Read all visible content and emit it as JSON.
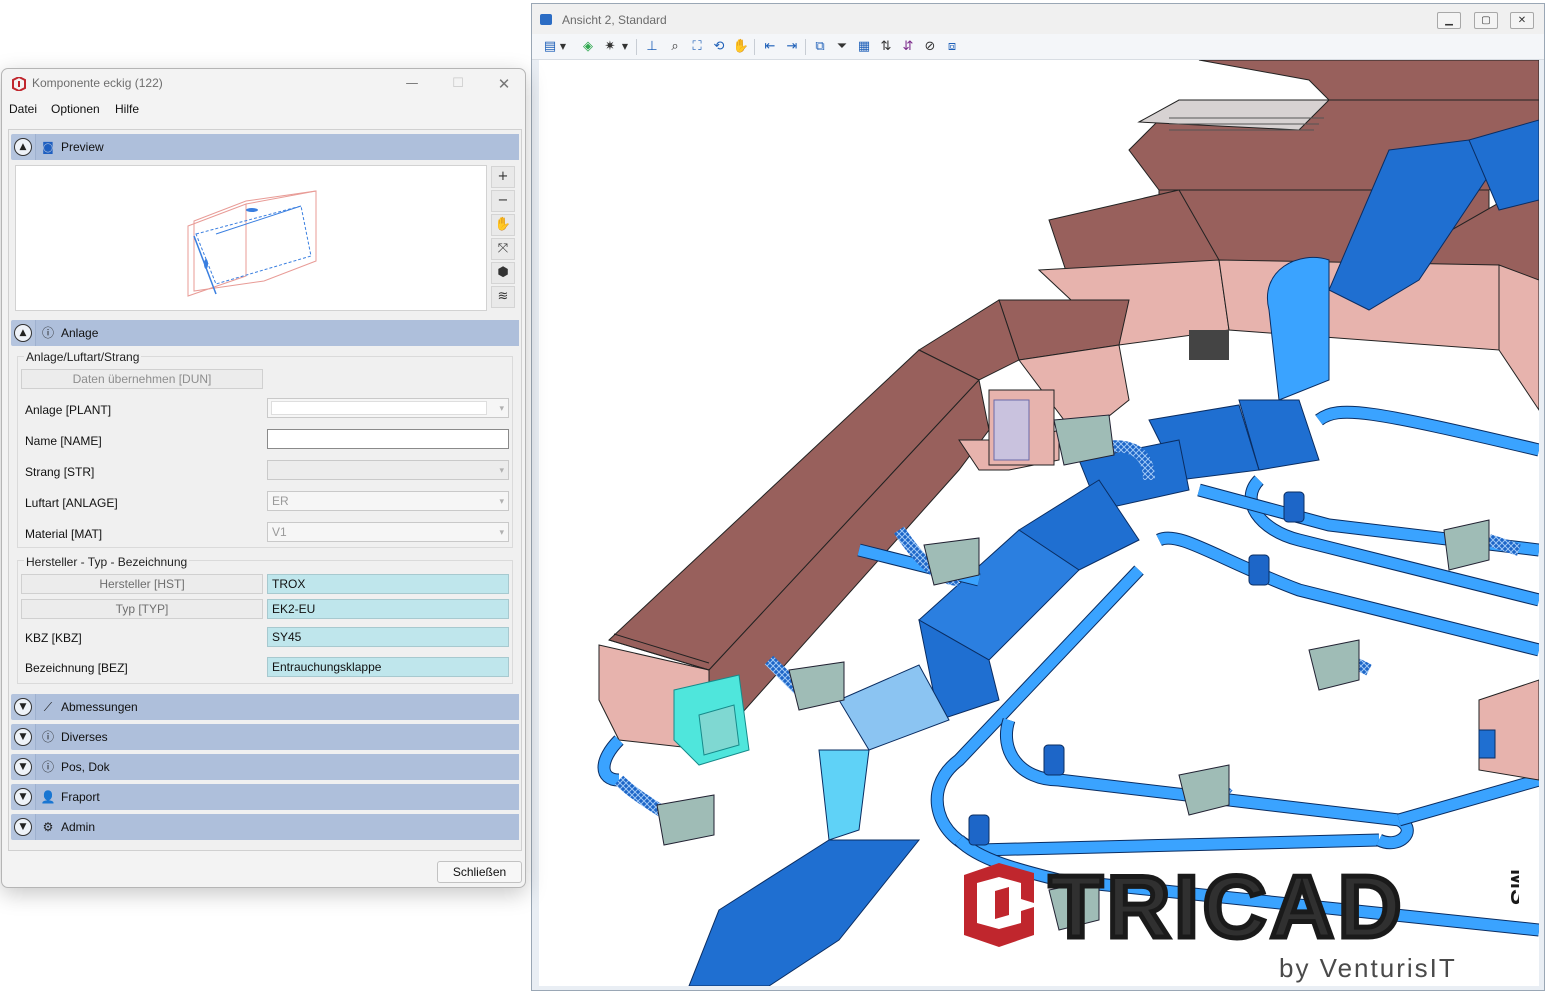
{
  "dialog": {
    "title": "Komponente eckig (122)",
    "menu": [
      "Datei",
      "Optionen",
      "Hilfe"
    ],
    "close_button": "Schließen",
    "sections": {
      "preview": "Preview",
      "anlage": "Anlage",
      "abmessungen": "Abmessungen",
      "diverses": "Diverses",
      "pos_dok": "Pos, Dok",
      "fraport": "Fraport",
      "admin": "Admin"
    },
    "anlage_group": {
      "title": "Anlage/Luftart/Strang",
      "apply_button": "Daten übernehmen [DUN]",
      "fields": {
        "anlage": {
          "label": "Anlage [PLANT]",
          "value": ""
        },
        "name": {
          "label": "Name [NAME]",
          "value": ""
        },
        "strang": {
          "label": "Strang [STR]",
          "value": ""
        },
        "luftart": {
          "label": "Luftart [ANLAGE]",
          "value": "ER"
        },
        "material": {
          "label": "Material [MAT]",
          "value": "V1"
        }
      }
    },
    "hersteller_group": {
      "title": "Hersteller - Typ - Bezeichnung",
      "fields": {
        "hersteller": {
          "label": "Hersteller [HST]",
          "value": "TROX"
        },
        "typ": {
          "label": "Typ [TYP]",
          "value": "EK2-EU"
        },
        "kbz": {
          "label": "KBZ [KBZ]",
          "value": "SY45"
        },
        "bezeichnung": {
          "label": "Bezeichnung [BEZ]",
          "value": "Entrauchungsklappe"
        }
      }
    }
  },
  "view": {
    "title": "Ansicht 2, Standard"
  },
  "watermark": {
    "logo_text": "TRICAD",
    "suffix": "MS",
    "byline": "by VenturisIT"
  },
  "colors": {
    "brown_duct": "#98605c",
    "pink_duct": "#e7b3ad",
    "blue_duct": "#1f6fd1",
    "light_blue": "#3aa3ff",
    "cyan_highlight": "#4fe6dc",
    "logo_red": "#c0262d"
  }
}
